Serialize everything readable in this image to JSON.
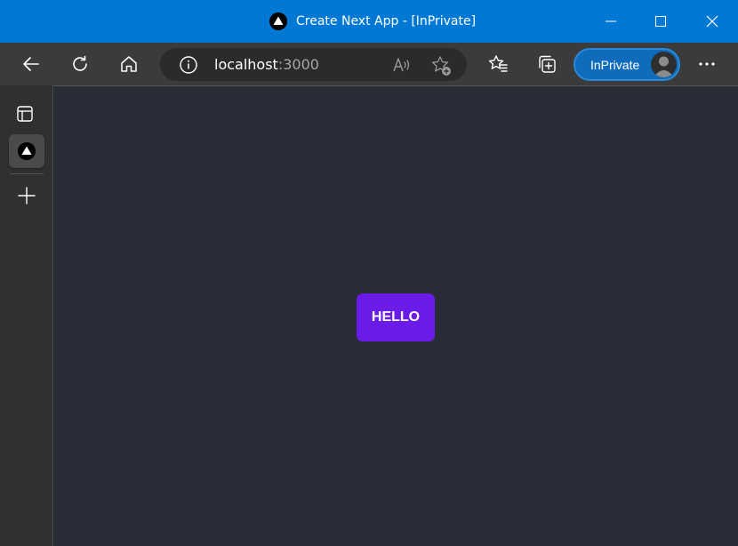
{
  "window": {
    "title": "Create Next App - [InPrivate]"
  },
  "toolbar": {
    "url_host": "localhost",
    "url_port": ":3000",
    "inprivate_label": "InPrivate"
  },
  "page": {
    "button_label": "HELLO",
    "button_color": "#6a1be8",
    "background_color": "#282c37"
  },
  "icons": {
    "back": "back-arrow-icon",
    "refresh": "refresh-icon",
    "home": "home-icon",
    "info": "info-icon",
    "read_aloud": "read-aloud-icon",
    "add_favorite": "add-favorite-icon",
    "favorites": "favorites-icon",
    "collections": "collections-icon",
    "more": "more-icon",
    "minimize": "minimize-icon",
    "maximize": "maximize-icon",
    "close": "close-icon",
    "tab_actions": "tab-actions-icon",
    "new_tab": "new-tab-icon",
    "nextjs": "nextjs-icon"
  }
}
